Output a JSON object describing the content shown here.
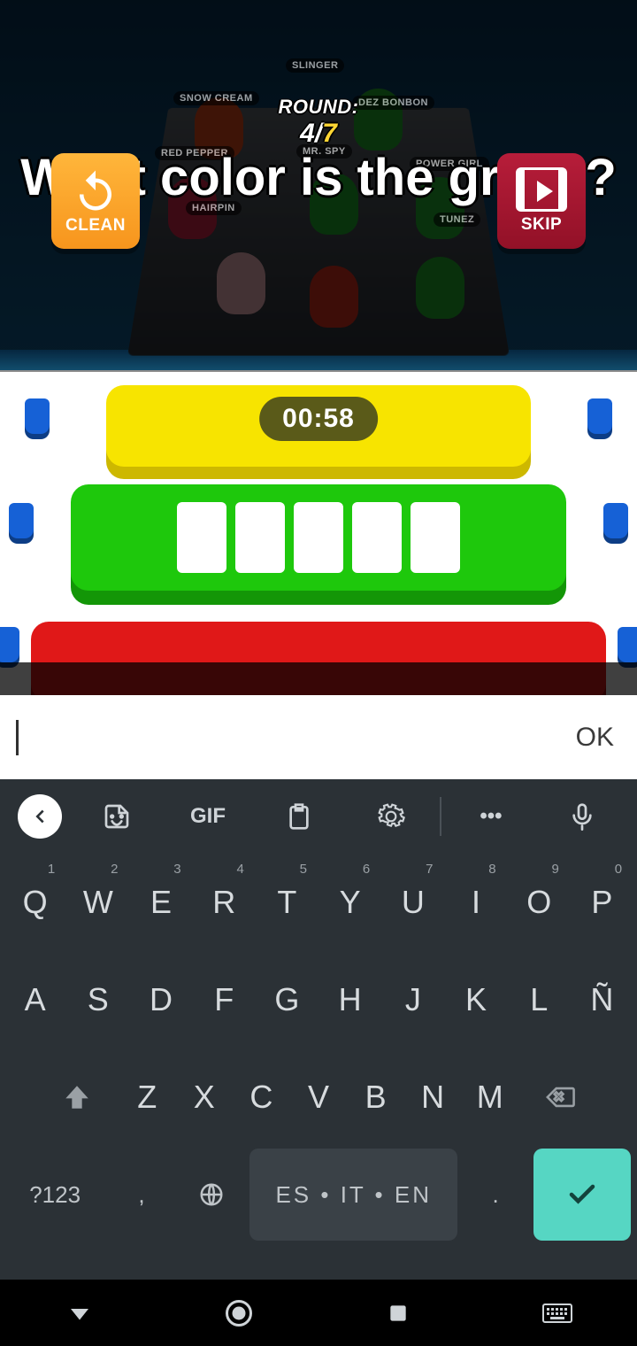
{
  "round": {
    "label": "ROUND:",
    "current": "4",
    "separator": "/",
    "total": "7"
  },
  "question": "What color is the grass?",
  "buttons": {
    "clean": "CLEAN",
    "skip": "SKIP"
  },
  "timer": "00:58",
  "answer_slots": 5,
  "slabs": {
    "yellow": "#f7e400",
    "green": "#1ec80c",
    "red": "#e01818"
  },
  "player_tags": [
    "SLINGER",
    "SNOW CREAM",
    "DEZ BONBON",
    "RED PEPPER",
    "MR. SPY",
    "POWER GIRL",
    "HAIRPIN",
    "TUNEZ"
  ],
  "input": {
    "value": "",
    "ok": "OK"
  },
  "keyboard": {
    "toolbar": {
      "gif": "GIF",
      "more": "•••"
    },
    "row1": [
      {
        "l": "Q",
        "n": "1"
      },
      {
        "l": "W",
        "n": "2"
      },
      {
        "l": "E",
        "n": "3"
      },
      {
        "l": "R",
        "n": "4"
      },
      {
        "l": "T",
        "n": "5"
      },
      {
        "l": "Y",
        "n": "6"
      },
      {
        "l": "U",
        "n": "7"
      },
      {
        "l": "I",
        "n": "8"
      },
      {
        "l": "O",
        "n": "9"
      },
      {
        "l": "P",
        "n": "0"
      }
    ],
    "row2": [
      "A",
      "S",
      "D",
      "F",
      "G",
      "H",
      "J",
      "K",
      "L",
      "Ñ"
    ],
    "row3": [
      "Z",
      "X",
      "C",
      "V",
      "B",
      "N",
      "M"
    ],
    "row4": {
      "sym": "?123",
      "comma": ",",
      "space": "ES • IT • EN",
      "dot": "."
    }
  }
}
